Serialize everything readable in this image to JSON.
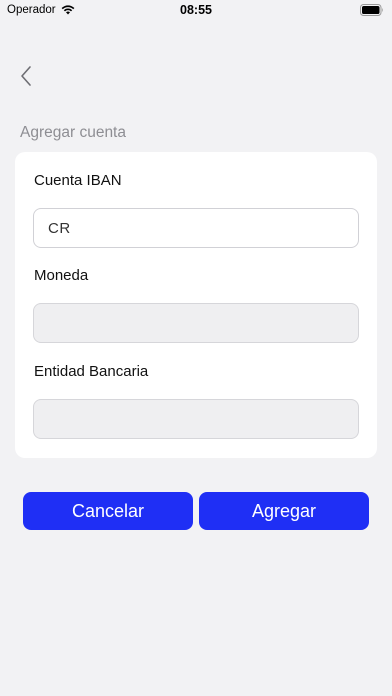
{
  "status_bar": {
    "carrier": "Operador",
    "time": "08:55"
  },
  "header": {
    "back_icon": "chevron-left-icon",
    "section_title": "Agregar cuenta"
  },
  "form": {
    "iban": {
      "label": "Cuenta IBAN",
      "value": "CR"
    },
    "currency": {
      "label": "Moneda",
      "value": ""
    },
    "bank": {
      "label": "Entidad Bancaria",
      "value": ""
    }
  },
  "actions": {
    "cancel_label": "Cancelar",
    "add_label": "Agregar"
  },
  "colors": {
    "primary_button": "#1f2ff5",
    "background": "#f2f2f4",
    "card": "#ffffff",
    "muted_text": "#8e8e93"
  }
}
